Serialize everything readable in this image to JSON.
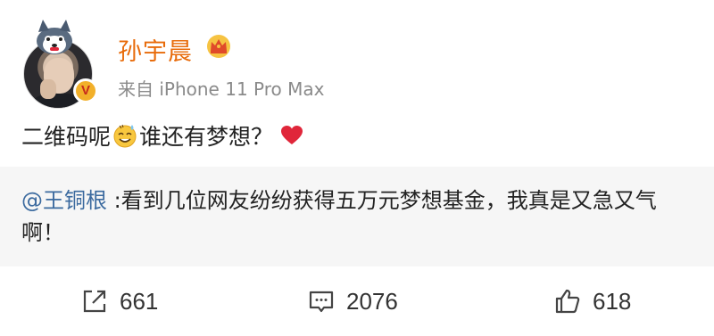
{
  "post": {
    "author": "孙宇晨",
    "source": "来自 iPhone 11 Pro Max",
    "verified_badge": "V",
    "text_part1": "二维码呢",
    "text_part2": "谁还有梦想？",
    "emoji_icon": "sweat-smile-emoji",
    "heart_icon": "red-heart-emoji"
  },
  "repost": {
    "mention": "@王铜根",
    "text": " :看到几位网友纷纷获得五万元梦想基金，我真是又急又气啊！"
  },
  "actions": {
    "repost_count": "661",
    "comment_count": "2076",
    "like_count": "618"
  },
  "colors": {
    "author_name": "#e86b0a",
    "mention": "#3b6a9f",
    "repost_bg": "#f6f6f6",
    "heart": "#e0263a"
  }
}
